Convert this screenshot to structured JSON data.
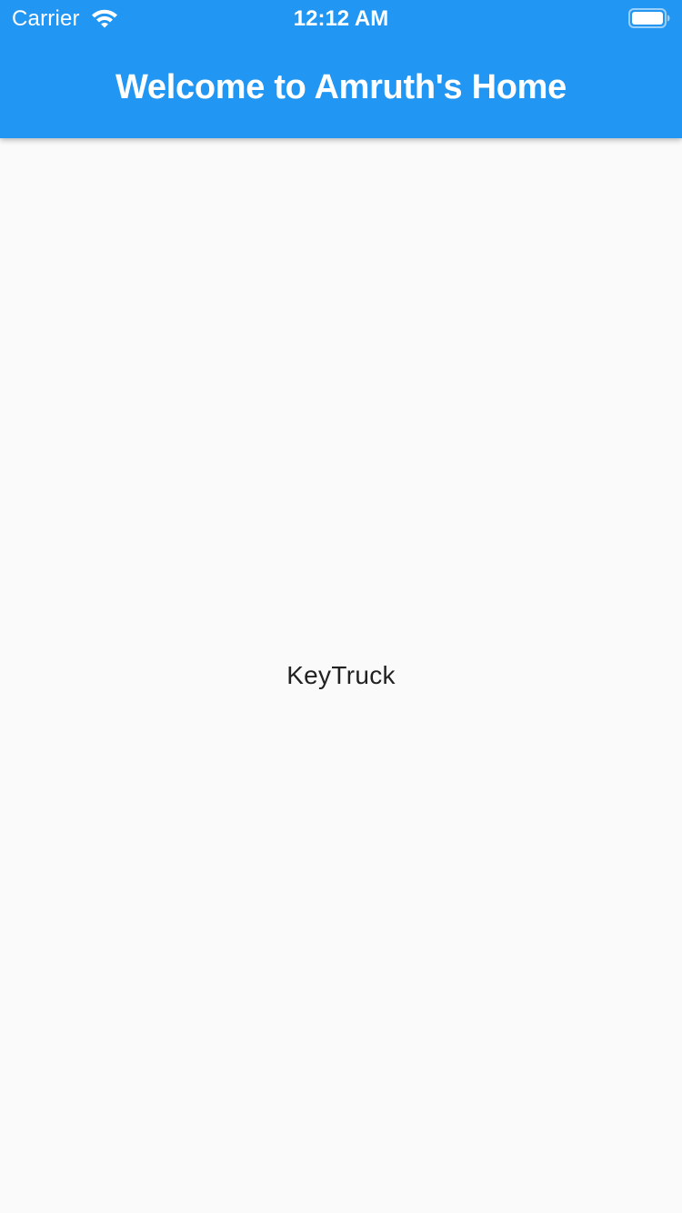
{
  "status_bar": {
    "carrier": "Carrier",
    "time": "12:12 AM",
    "icons": [
      "wifi-icon",
      "battery-icon"
    ]
  },
  "app_bar": {
    "title": "Welcome to Amruth's Home"
  },
  "body": {
    "text": "KeyTruck"
  },
  "colors": {
    "app_bar": "#2196f3",
    "background": "#fafafa",
    "text": "#212121",
    "on_primary": "#ffffff"
  }
}
